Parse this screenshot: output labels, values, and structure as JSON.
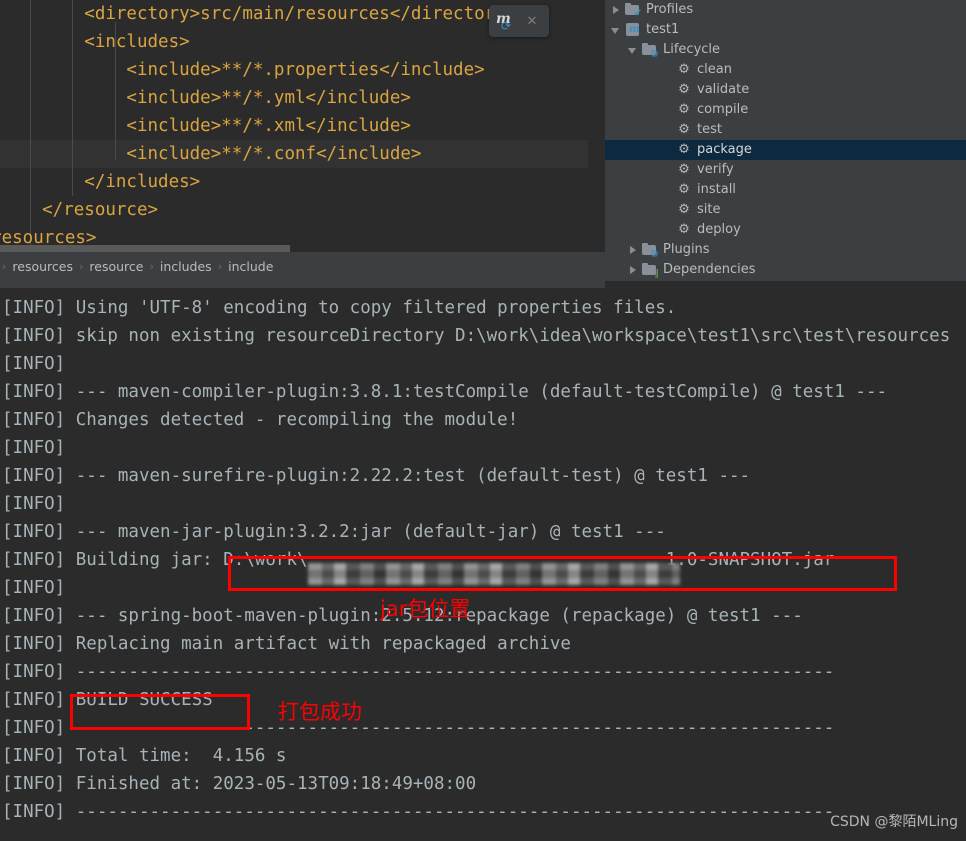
{
  "editor": {
    "code_lines": [
      "        <directory>src/main/resources</directory>",
      "        <includes>",
      "            <include>**/*.properties</include>",
      "            <include>**/*.yml</include>",
      "            <include>**/*.xml</include>",
      "            <include>**/*.conf</include>",
      "        </includes>",
      "    </resource>",
      "</resources>"
    ],
    "breadcrumb": [
      "resources",
      "resource",
      "includes",
      "include"
    ],
    "breadcrumb_separator": "›",
    "popup": {
      "icon_letter": "m",
      "refresh_glyph": "⟳",
      "close_glyph": "✕"
    }
  },
  "maven_panel": {
    "tree": [
      {
        "label": "Profiles",
        "indent": 0,
        "arrow": "right",
        "icon": "folder-check",
        "selected": false
      },
      {
        "label": "test1",
        "indent": 0,
        "arrow": "down",
        "icon": "maven-module",
        "selected": false
      },
      {
        "label": "Lifecycle",
        "indent": 1,
        "arrow": "down",
        "icon": "folder-gear",
        "selected": false
      },
      {
        "label": "clean",
        "indent": 3,
        "arrow": "none",
        "icon": "gear",
        "selected": false
      },
      {
        "label": "validate",
        "indent": 3,
        "arrow": "none",
        "icon": "gear",
        "selected": false
      },
      {
        "label": "compile",
        "indent": 3,
        "arrow": "none",
        "icon": "gear",
        "selected": false
      },
      {
        "label": "test",
        "indent": 3,
        "arrow": "none",
        "icon": "gear",
        "selected": false
      },
      {
        "label": "package",
        "indent": 3,
        "arrow": "none",
        "icon": "gear",
        "selected": true
      },
      {
        "label": "verify",
        "indent": 3,
        "arrow": "none",
        "icon": "gear",
        "selected": false
      },
      {
        "label": "install",
        "indent": 3,
        "arrow": "none",
        "icon": "gear",
        "selected": false
      },
      {
        "label": "site",
        "indent": 3,
        "arrow": "none",
        "icon": "gear",
        "selected": false
      },
      {
        "label": "deploy",
        "indent": 3,
        "arrow": "none",
        "icon": "gear",
        "selected": false
      },
      {
        "label": "Plugins",
        "indent": 1,
        "arrow": "right",
        "icon": "folder-gear",
        "selected": false
      },
      {
        "label": "Dependencies",
        "indent": 1,
        "arrow": "right",
        "icon": "folder-bars",
        "selected": false
      }
    ],
    "gear_glyph": "⚙",
    "check_glyph": "✔",
    "bars_glyph": "‖"
  },
  "console": {
    "lines": [
      "[INFO] Using 'UTF-8' encoding to copy filtered properties files.",
      "[INFO] skip non existing resourceDirectory D:\\work\\idea\\workspace\\test1\\src\\test\\resources",
      "[INFO]",
      "[INFO] --- maven-compiler-plugin:3.8.1:testCompile (default-testCompile) @ test1 ---",
      "[INFO] Changes detected - recompiling the module!",
      "[INFO]",
      "[INFO] --- maven-surefire-plugin:2.22.2:test (default-test) @ test1 ---",
      "[INFO]",
      "[INFO] --- maven-jar-plugin:3.2.2:jar (default-jar) @ test1 ---",
      "[INFO] Building jar: D:\\work\\                                  1.0-SNAPSHOT.jar",
      "[INFO]",
      "[INFO] --- spring-boot-maven-plugin:2.5.12:repackage (repackage) @ test1 ---",
      "[INFO] Replacing main artifact with repackaged archive",
      "[INFO] ------------------------------------------------------------------------",
      "[INFO] BUILD SUCCESS",
      "[INFO] ------------------------------------------------------------------------",
      "[INFO] Total time:  4.156 s",
      "[INFO] Finished at: 2023-05-13T09:18:49+08:00",
      "[INFO] ------------------------------------------------------------------------"
    ]
  },
  "annotations": {
    "jar_location_label": "jar包位置",
    "build_success_label": "打包成功",
    "highlight_color": "#ff0000"
  },
  "watermark": {
    "text": "CSDN @黎陌MLing"
  }
}
